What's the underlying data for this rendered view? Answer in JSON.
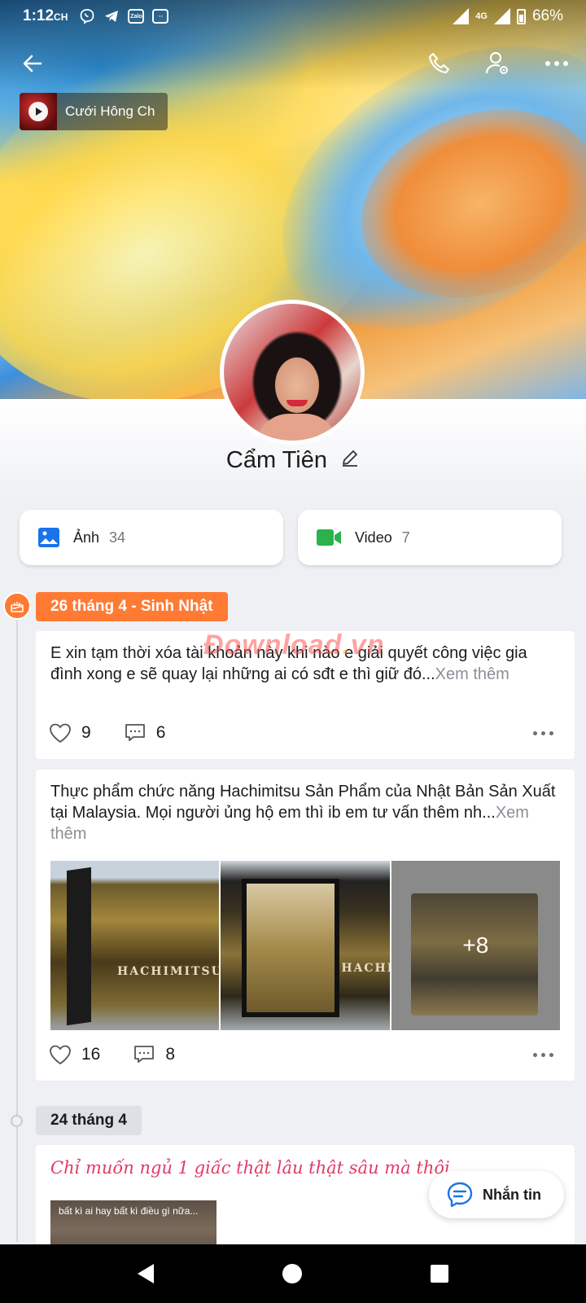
{
  "status_bar": {
    "time": "1:12",
    "time_suffix": "CH",
    "network": "4G",
    "battery": "66%",
    "notification_icons": [
      "viber-icon",
      "telegram-icon",
      "zalo-icon",
      "messenger-icon"
    ]
  },
  "cover": {
    "music_title": "Cưới Hông Ch"
  },
  "profile": {
    "name": "Cẩm Tiên"
  },
  "media": {
    "photos_label": "Ảnh",
    "photos_count": "34",
    "videos_label": "Video",
    "videos_count": "7"
  },
  "watermark": "Download.vn",
  "timeline": {
    "birthday_chip": "26 tháng 4 - Sinh Nhật",
    "date_chip_2": "24 tháng 4",
    "posts": [
      {
        "text": "E xin tạm thời xóa tài khoản này khi nào e giải quyết công việc gia đình xong e sẽ quay lại những ai có sđt e thì giữ đó...",
        "more": "Xem thêm",
        "likes": "9",
        "comments": "6"
      },
      {
        "text": "Thực phẩm chức năng Hachimitsu Sản Phẩm của Nhật Bản Sản Xuất tại Malaysia. Mọi người ủng hộ em thì ib em tư vấn thêm nh...",
        "more": "Xem thêm",
        "photo_brand": "HACHIMITSU",
        "photo_brand_2": "HACHI",
        "extra_photos": "+8",
        "likes": "16",
        "comments": "8"
      },
      {
        "status": "Chỉ muốn ngủ 1 giấc thật lâu thật sâu mà thôi",
        "video_caption": "bất kì ai hay bất kì điều gì nữa..."
      }
    ]
  },
  "message_button": {
    "label": "Nhắn tin"
  },
  "colors": {
    "accent_orange": "#ff7a33",
    "status_pink": "#e23a66",
    "link_gray": "#8a8f96",
    "photo_icon": "#1a73e8",
    "video_icon": "#2bb24c"
  }
}
